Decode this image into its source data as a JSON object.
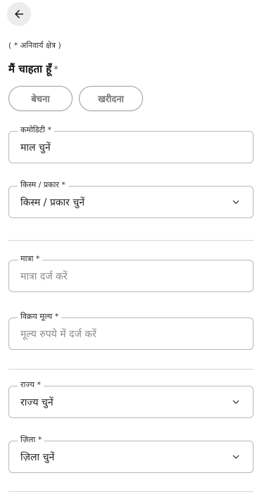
{
  "header": {
    "back_icon": "arrow-left-icon"
  },
  "required_note": "( * अनिवार्य क्षेत्र )",
  "intent": {
    "title": "मैं चाहता हूँ",
    "star": "*",
    "sell_label": "बेचना",
    "buy_label": "खरीदना"
  },
  "fields": {
    "commodity": {
      "label": "कमोडिटी *",
      "value": "माल चुनें"
    },
    "variety": {
      "label": "किस्म / प्रकार *",
      "value": "किस्म / प्रकार चुनें"
    },
    "quantity": {
      "label": "मात्रा *",
      "placeholder": "मात्रा दर्ज करें"
    },
    "price": {
      "label": "विक्रय मूल्य *",
      "placeholder": "मूल्य रुपये में दर्ज करें"
    },
    "state": {
      "label": "राज्य *",
      "value": "राज्य चुनें"
    },
    "district": {
      "label": "ज़िला *",
      "value": "ज़िला चुनें"
    }
  }
}
